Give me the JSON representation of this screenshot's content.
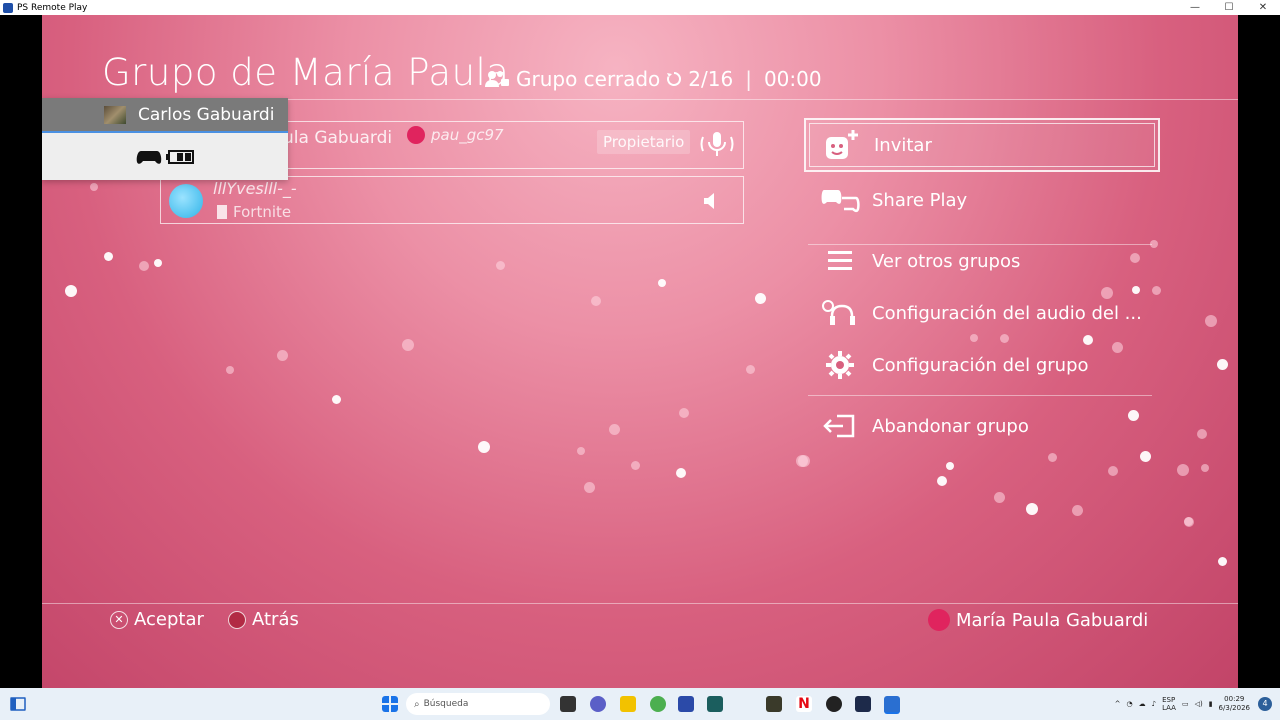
{
  "window": {
    "title": "PS Remote Play",
    "minimize": "—",
    "maximize": "☐",
    "close": "✕"
  },
  "header": {
    "title": "Grupo de María Paula",
    "privacy": "Grupo cerrado",
    "count": "2/16",
    "timer": "00:00"
  },
  "popup": {
    "user": "Carlos Gabuardi"
  },
  "members": [
    {
      "name_partial": "ula Gabuardi",
      "online_id": "pau_gc97",
      "role": "Propietario"
    },
    {
      "online_id": "lllYveslll-_-",
      "game": "Fortnite"
    }
  ],
  "menu": {
    "items": [
      {
        "label": "Invitar",
        "icon": "invite-icon"
      },
      {
        "label": "Share Play",
        "icon": "share-play-icon"
      },
      {
        "label": "Ver otros grupos",
        "icon": "list-icon"
      },
      {
        "label": "Configuración del audio del ...",
        "icon": "audio-settings-icon"
      },
      {
        "label": "Configuración del grupo",
        "icon": "gear-icon"
      },
      {
        "label": "Abandonar grupo",
        "icon": "leave-icon"
      }
    ],
    "selected": "Invitar"
  },
  "footer": {
    "accept": "Aceptar",
    "back": "Atrás",
    "current_user": "María Paula Gabuardi"
  },
  "taskbar": {
    "search_placeholder": "Búsqueda",
    "lang_top": "ESP",
    "lang_bottom": "LAA",
    "time": "00:29",
    "date": "6/3/2026",
    "notifications": "4"
  },
  "colors": {
    "accent": "#e0245e",
    "screen_bg": "#d8607f",
    "taskbar": "#e8f0f8"
  }
}
